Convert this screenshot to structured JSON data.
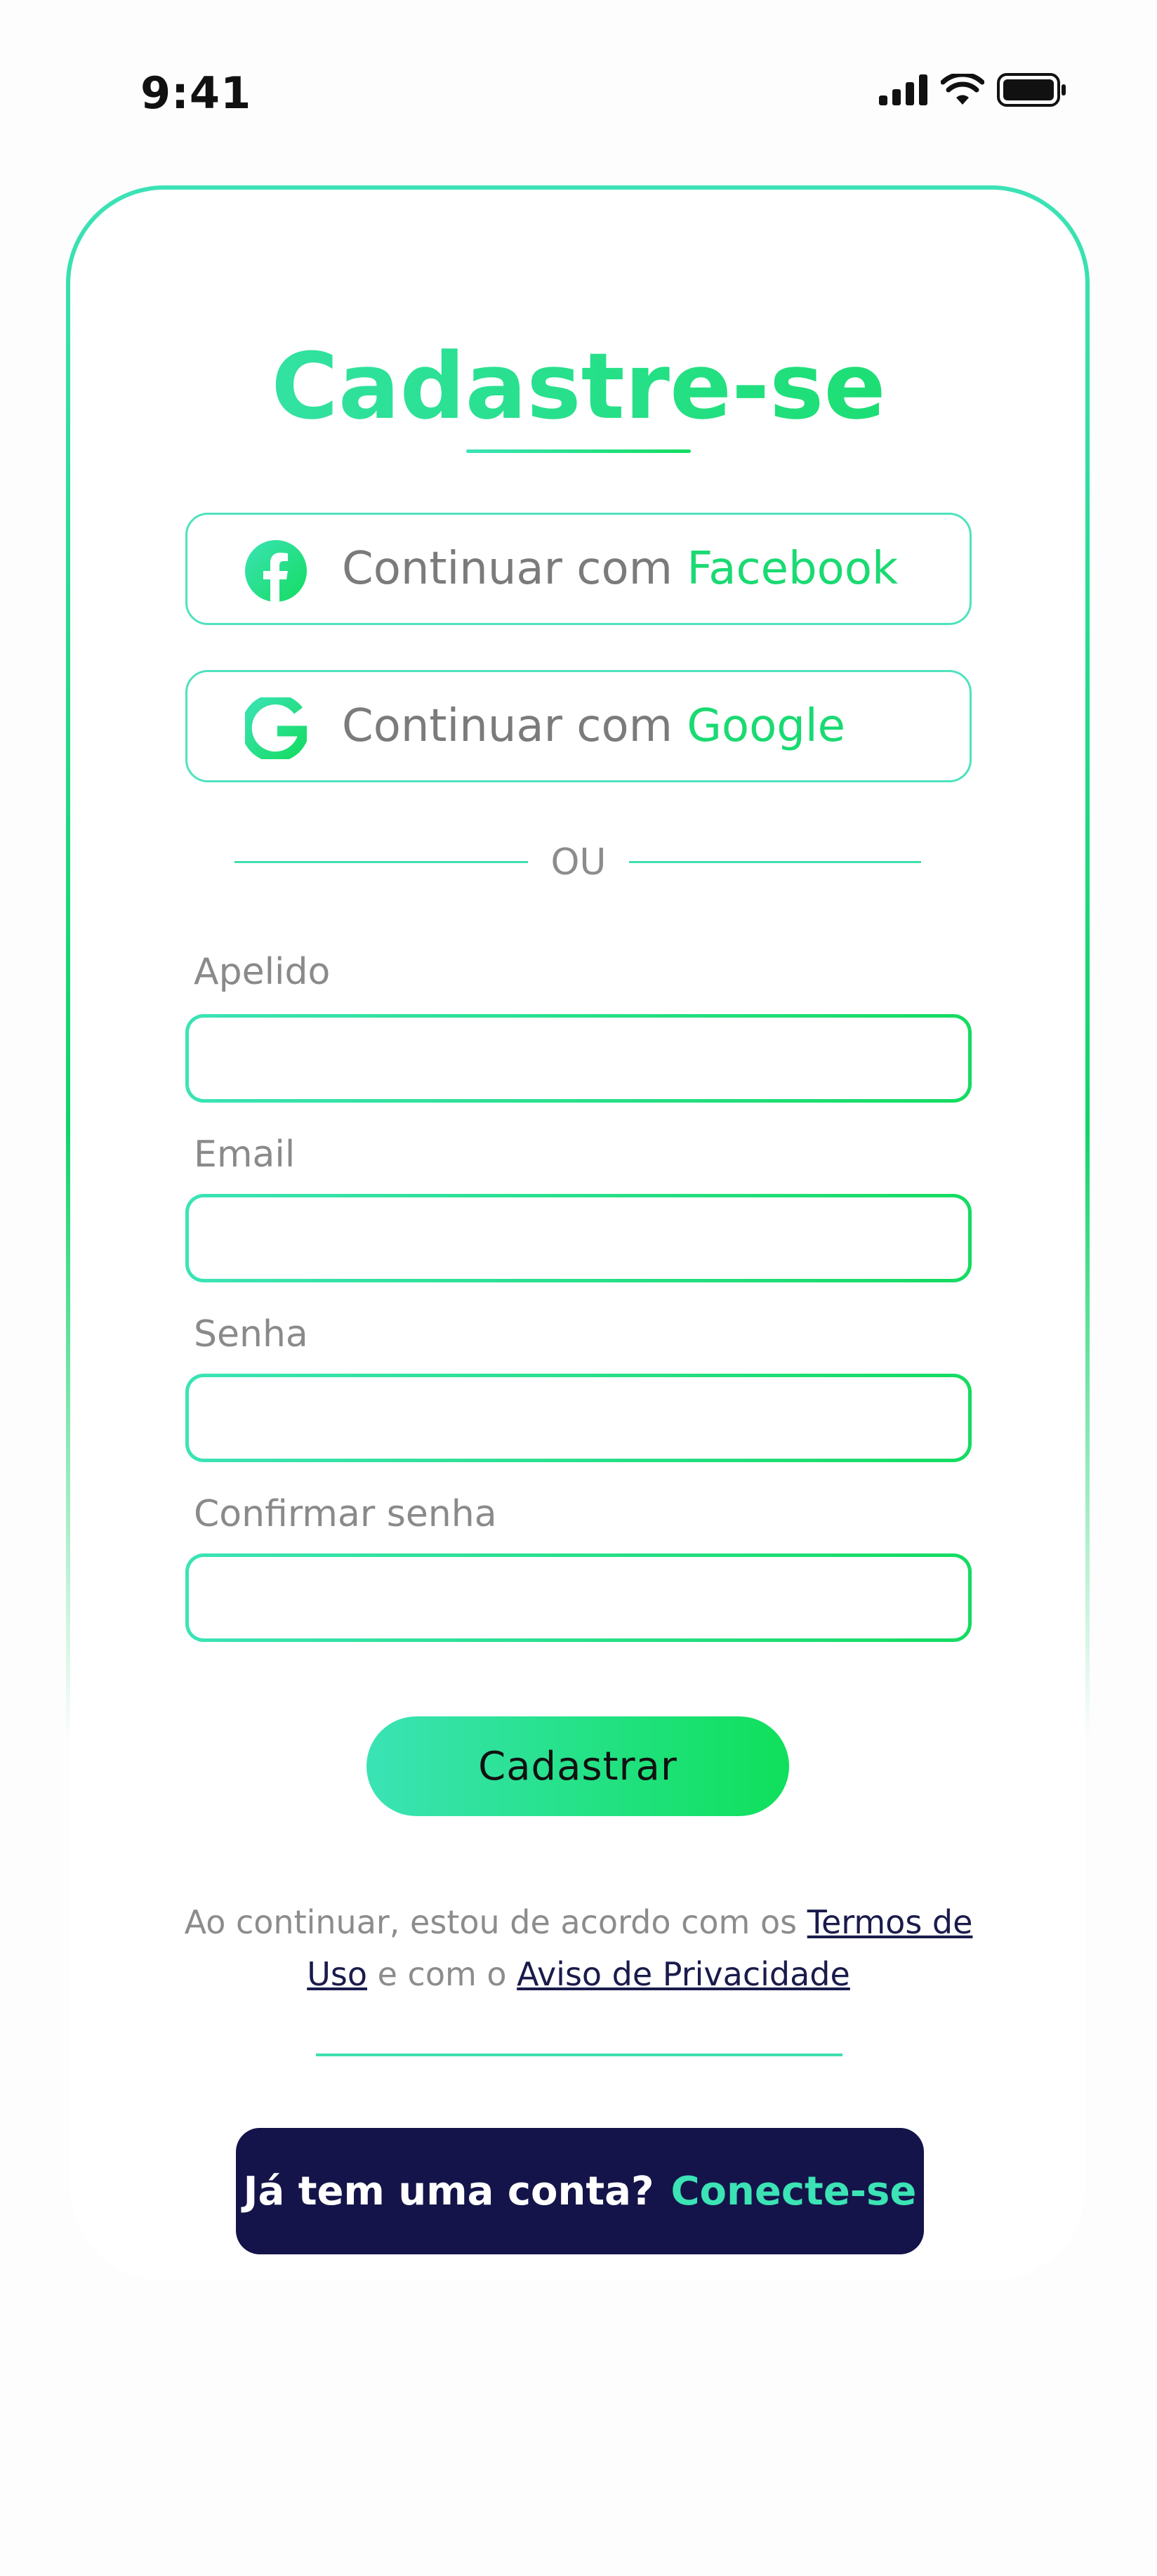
{
  "status_bar": {
    "time": "9:41"
  },
  "title": "Cadastre-se",
  "social": {
    "facebook": {
      "prefix": "Continuar com ",
      "brand": "Facebook",
      "icon": "facebook-icon"
    },
    "google": {
      "prefix": "Continuar com ",
      "brand": "Google",
      "icon": "google-icon"
    }
  },
  "divider": "OU",
  "form": {
    "fields": [
      {
        "label": "Apelido",
        "value": ""
      },
      {
        "label": "Email",
        "value": ""
      },
      {
        "label": "Senha",
        "value": ""
      },
      {
        "label": "Confirmar senha",
        "value": ""
      }
    ],
    "submit_label": "Cadastrar"
  },
  "terms": {
    "text_before": "Ao continuar, estou de acordo com os ",
    "terms_link": "Termos de Uso",
    "text_middle": " e com o ",
    "privacy_link": " Aviso de Privacidade"
  },
  "login": {
    "question": "Já tem uma conta?",
    "link": "Conecte-se"
  },
  "colors": {
    "accent_teal": "#3be3b5",
    "accent_green": "#13dd60",
    "banner_navy": "#14144a"
  }
}
